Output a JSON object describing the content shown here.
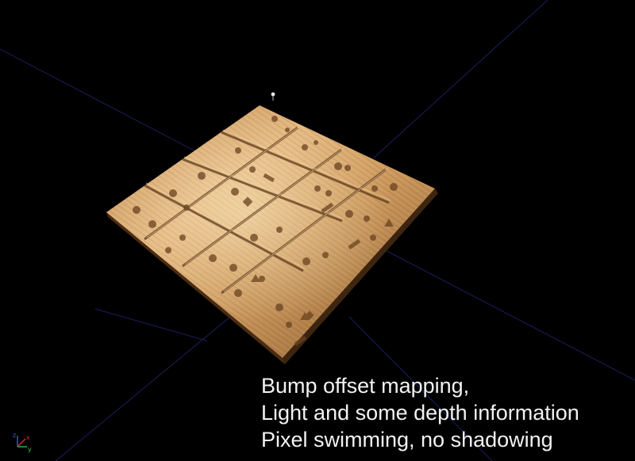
{
  "viewport": {
    "background": "#000000",
    "grid_color": "#1c1c5a",
    "wood_light": "#d9a870",
    "wood_mid": "#b9844a",
    "wood_dark": "#6b4321"
  },
  "caption": {
    "line1": "Bump offset mapping,",
    "line2": "Light and some depth information",
    "line3": "Pixel swimming, no shadowing"
  },
  "gizmo": {
    "x_label": "x",
    "y_label": "y",
    "z_label": "z",
    "x_color": "#d23030",
    "y_color": "#30c050",
    "z_color": "#3a5bd8"
  }
}
